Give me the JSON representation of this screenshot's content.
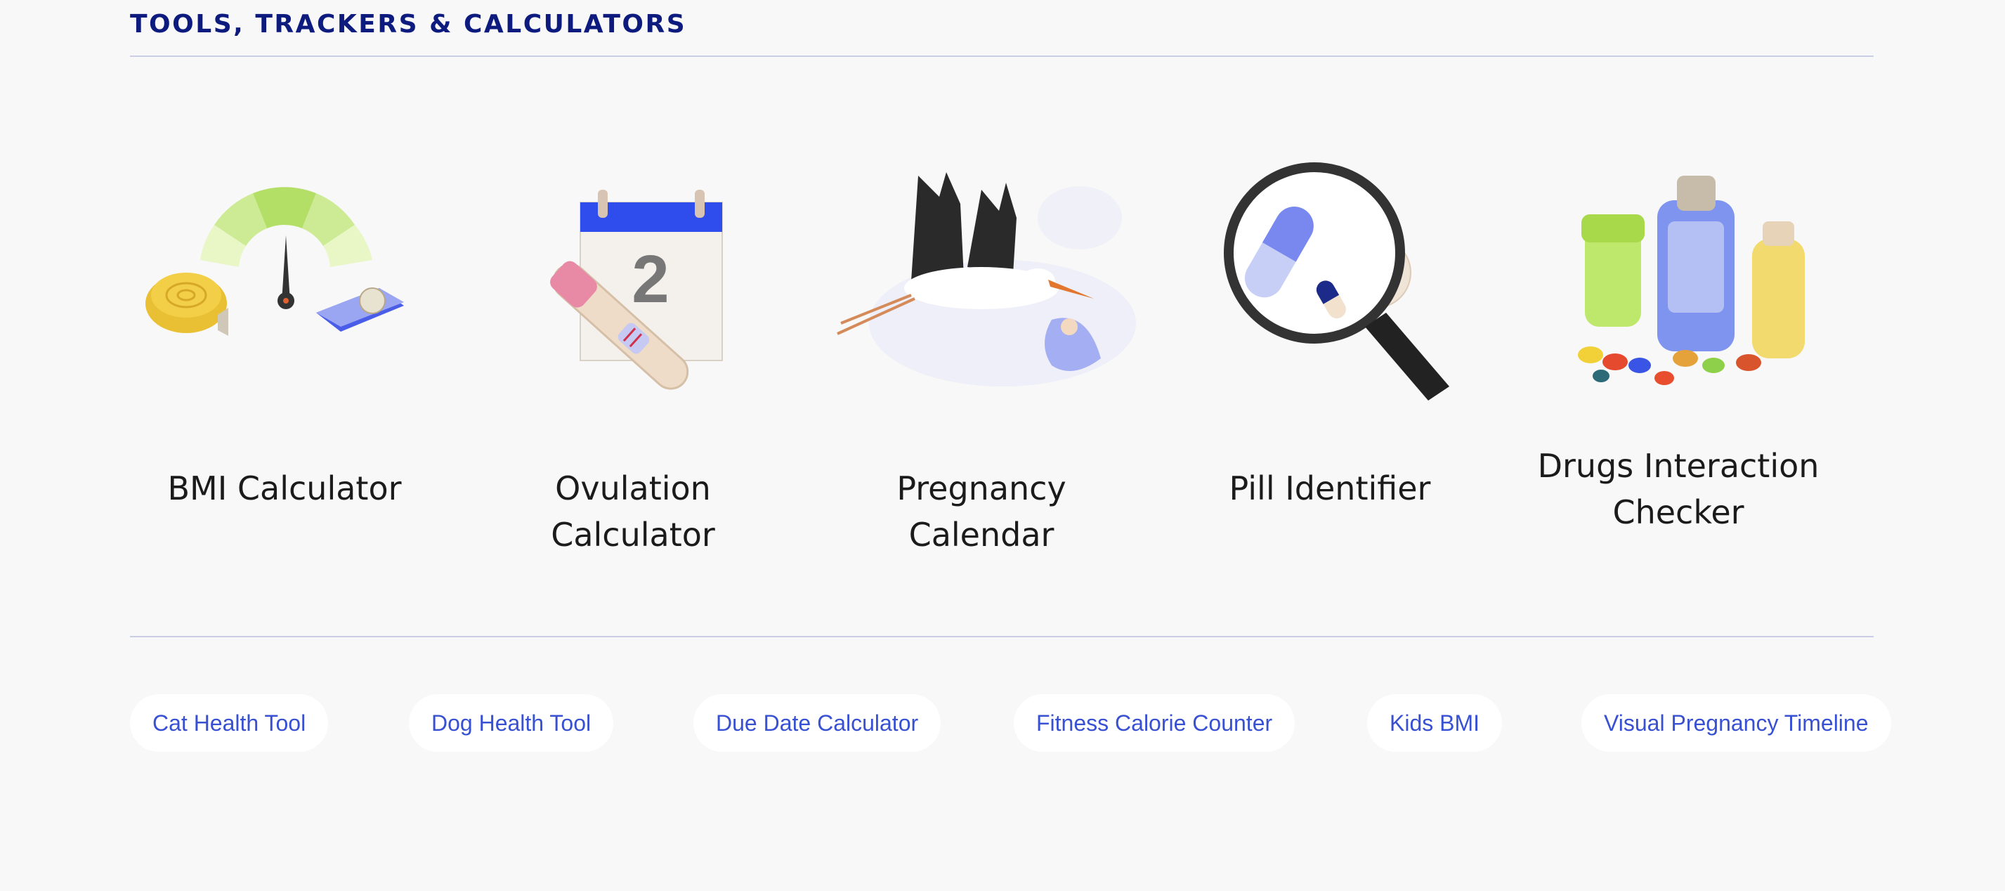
{
  "section": {
    "title": "TOOLS, TRACKERS & CALCULATORS"
  },
  "tools": [
    {
      "label": "BMI Calculator",
      "icon": "bmi-scale-icon"
    },
    {
      "label": "Ovulation Calculator",
      "icon": "ovulation-calendar-icon",
      "calendar_day": "2"
    },
    {
      "label": "Pregnancy Calendar",
      "icon": "stork-icon"
    },
    {
      "label": "Pill Identifier",
      "icon": "magnifier-pill-icon"
    },
    {
      "label_line1": "Drugs Interaction",
      "label_line2": "Checker",
      "icon": "pill-bottles-icon"
    }
  ],
  "links": [
    "Cat Health Tool",
    "Dog Health Tool",
    "Due Date Calculator",
    "Fitness Calorie Counter",
    "Kids BMI",
    "Visual Pregnancy Timeline"
  ],
  "colors": {
    "heading": "#0d1b7e",
    "link": "#3850d2",
    "rule": "#c9cde6",
    "background": "#f8f8f8"
  }
}
